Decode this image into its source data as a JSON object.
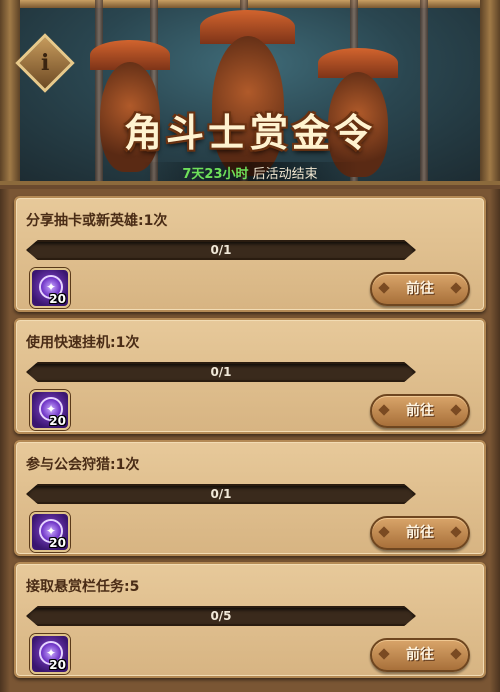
{
  "banner": {
    "title": "角斗士赏金令",
    "timer_highlight": "7天23小时",
    "timer_suffix": " 后活动结束",
    "info_label": "i"
  },
  "colors": {
    "timer_green": "#6ee05a",
    "reward_purple": "#6a2ec2",
    "button_brown": "#a8703a"
  },
  "tasks": [
    {
      "title": "分享抽卡或新英雄:1次",
      "progress_text": "0/1",
      "progress": 0,
      "reward_icon": "purple-star-coin-icon",
      "reward_count": "20",
      "button_label": "前往"
    },
    {
      "title": "使用快速挂机:1次",
      "progress_text": "0/1",
      "progress": 0,
      "reward_icon": "purple-star-coin-icon",
      "reward_count": "20",
      "button_label": "前往"
    },
    {
      "title": "参与公会狩猎:1次",
      "progress_text": "0/1",
      "progress": 0,
      "reward_icon": "purple-star-coin-icon",
      "reward_count": "20",
      "button_label": "前往"
    },
    {
      "title": "接取悬赏栏任务:5",
      "progress_text": "0/5",
      "progress": 0,
      "reward_icon": "purple-star-coin-icon",
      "reward_count": "20",
      "button_label": "前往"
    }
  ]
}
